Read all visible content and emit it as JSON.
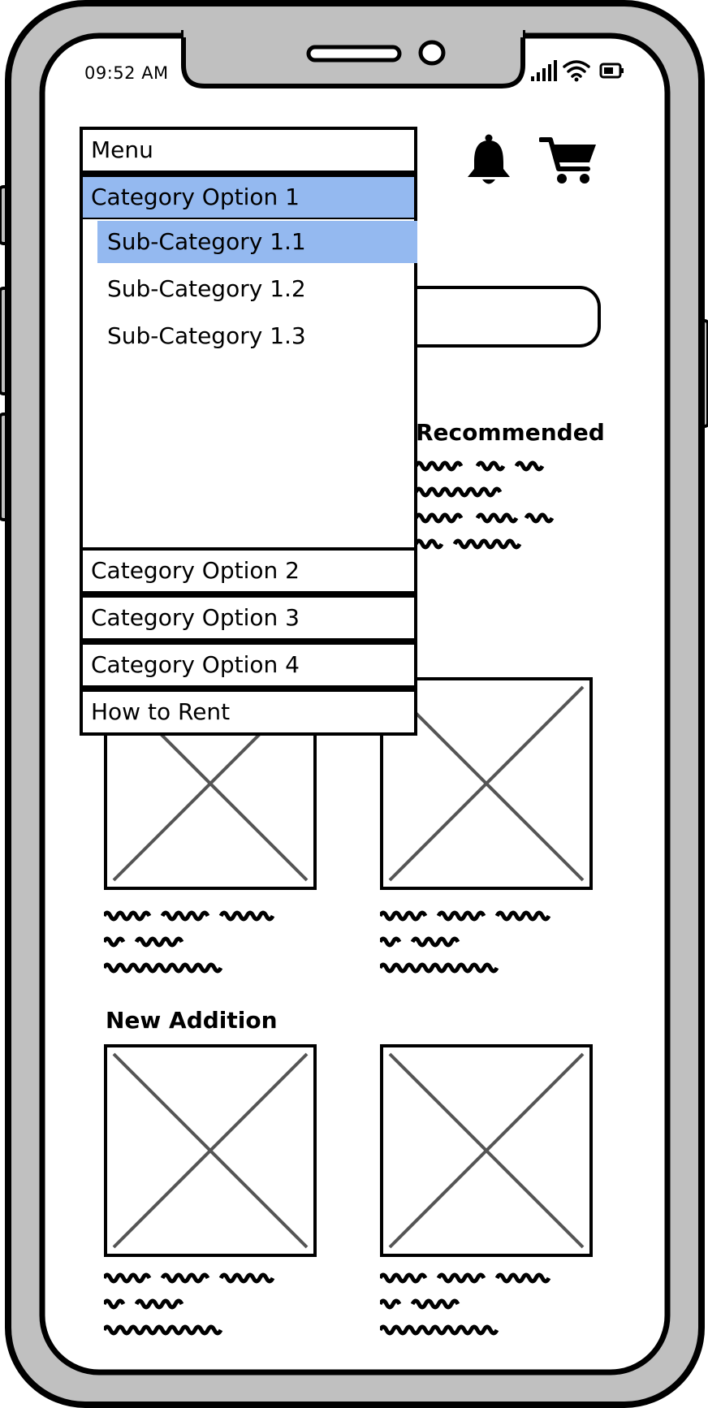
{
  "status_bar": {
    "time": "09:52 AM",
    "icons": [
      "signal-icon",
      "wifi-icon",
      "battery-icon"
    ]
  },
  "header": {
    "icons": [
      "bell-icon",
      "cart-icon"
    ]
  },
  "menu": {
    "title": "Menu",
    "categories": [
      {
        "label": "Category Option 1",
        "expanded": true,
        "subcategories": [
          {
            "label": "Sub-Category 1.1",
            "selected": true
          },
          {
            "label": "Sub-Category 1.2",
            "selected": false
          },
          {
            "label": "Sub-Category 1.3",
            "selected": false
          }
        ]
      },
      {
        "label": "Category Option 2"
      },
      {
        "label": "Category Option 3"
      },
      {
        "label": "Category Option 4"
      },
      {
        "label": "How to Rent"
      }
    ]
  },
  "sections": {
    "recommended": {
      "title": "Recommended"
    },
    "new_addition": {
      "title": "New Addition"
    }
  },
  "colors": {
    "highlight": "#94b9f0",
    "phone_frame": "#c0c0c0",
    "ink": "#000000",
    "placeholder_cross": "#555555"
  }
}
